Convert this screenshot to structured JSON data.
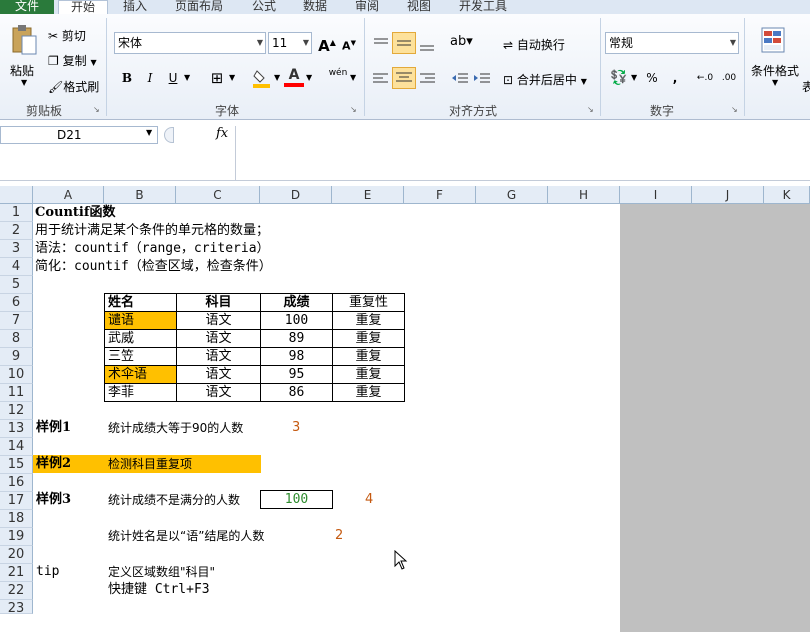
{
  "tabs": [
    "文件",
    "开始",
    "插入",
    "页面布局",
    "公式",
    "数据",
    "审阅",
    "视图",
    "开发工具"
  ],
  "clipboard": {
    "paste": "粘贴",
    "cut": "剪切",
    "copy": "复制",
    "format_painter": "格式刷",
    "group": "剪贴板"
  },
  "font": {
    "name": "宋体",
    "size": "11",
    "group": "字体",
    "bold": "B",
    "italic": "I",
    "underline": "U",
    "grow": "A",
    "shrink": "A",
    "border": "⊞",
    "wen": "wén",
    "fill_color": "#ffc000",
    "font_color": "#ff0000"
  },
  "alignment": {
    "wrap": "自动换行",
    "merge": "合并后居中",
    "group": "对齐方式"
  },
  "number": {
    "format": "常规",
    "percent": "%",
    "comma": ",",
    "group": "数字",
    "inc_dec": "←.0",
    "dec_dec": ".00"
  },
  "styles": {
    "cond_format": "条件格式",
    "more": "表"
  },
  "name_box": "D21",
  "fx": "fx",
  "columns": [
    "A",
    "B",
    "C",
    "D",
    "E",
    "F",
    "G",
    "H",
    "I",
    "J",
    "K"
  ],
  "rows": [
    "1",
    "2",
    "3",
    "4",
    "5",
    "6",
    "7",
    "8",
    "9",
    "10",
    "11",
    "12",
    "13",
    "14",
    "15",
    "16",
    "17",
    "18",
    "19",
    "20",
    "21",
    "22",
    "23"
  ],
  "text": {
    "r1": "Countif函数",
    "r2": "用于统计满足某个条件的单元格的数量；",
    "r3": "语法：countif（range，criteria）",
    "r4": "简化：countif（检查区域，检查条件）"
  },
  "table": {
    "headers": [
      "姓名",
      "科目",
      "成绩",
      "重复性"
    ],
    "rows": [
      [
        "谴语",
        "语文",
        "100",
        "重复"
      ],
      [
        "武威",
        "语文",
        "89",
        "重复"
      ],
      [
        "三笠",
        "语文",
        "98",
        "重复"
      ],
      [
        "术伞语",
        "语文",
        "95",
        "重复"
      ],
      [
        "李菲",
        "语文",
        "86",
        "重复"
      ]
    ],
    "highlight_color": "#ffc000"
  },
  "examples": {
    "ex1_label": "样例1",
    "ex1_desc": "统计成绩大等于90的人数",
    "ex1_result": "3",
    "ex2_label": "样例2",
    "ex2_desc": "检测科目重复项",
    "ex3_label": "样例3",
    "ex3_desc": "统计成绩不是满分的人数",
    "ex3_box": "100",
    "ex3_result": "4",
    "ex4_desc": "统计姓名是以“语”结尾的人数",
    "ex4_result": "2",
    "tip_label": "tip",
    "tip_line1": "定义区域数组\"科目\"",
    "tip_line2": "快捷键 Ctrl+F3"
  },
  "colors": {
    "result": "#c55a11",
    "green": "#2e8b2e",
    "accent": "#ffc000"
  }
}
